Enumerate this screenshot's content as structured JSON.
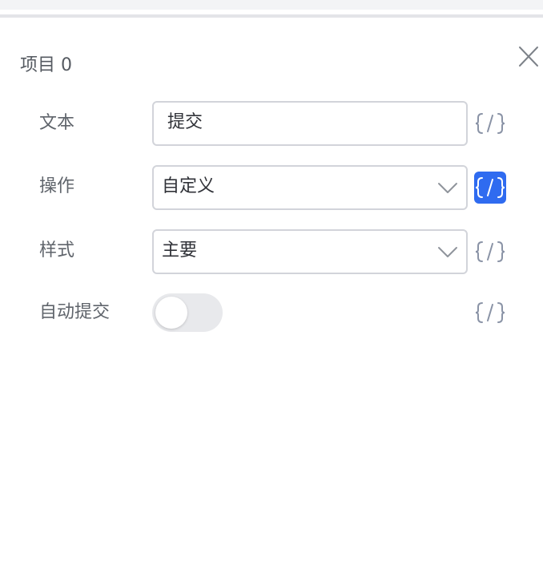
{
  "panel": {
    "title": "项目 0",
    "close_icon": "close-icon"
  },
  "fields": {
    "text": {
      "label": "文本",
      "value": "提交"
    },
    "action": {
      "label": "操作",
      "value": "自定义",
      "code_toggle_active": true
    },
    "style": {
      "label": "样式",
      "value": "主要"
    },
    "auto_submit": {
      "label": "自动提交",
      "enabled": false
    }
  },
  "icons": {
    "code": "code-braces-icon",
    "dropdown": "chevron-down-icon"
  },
  "colors": {
    "accent": "#2f6bf0",
    "code_icon_inactive": "#8a93a6",
    "toggle_off_track": "#e8e9ec"
  }
}
